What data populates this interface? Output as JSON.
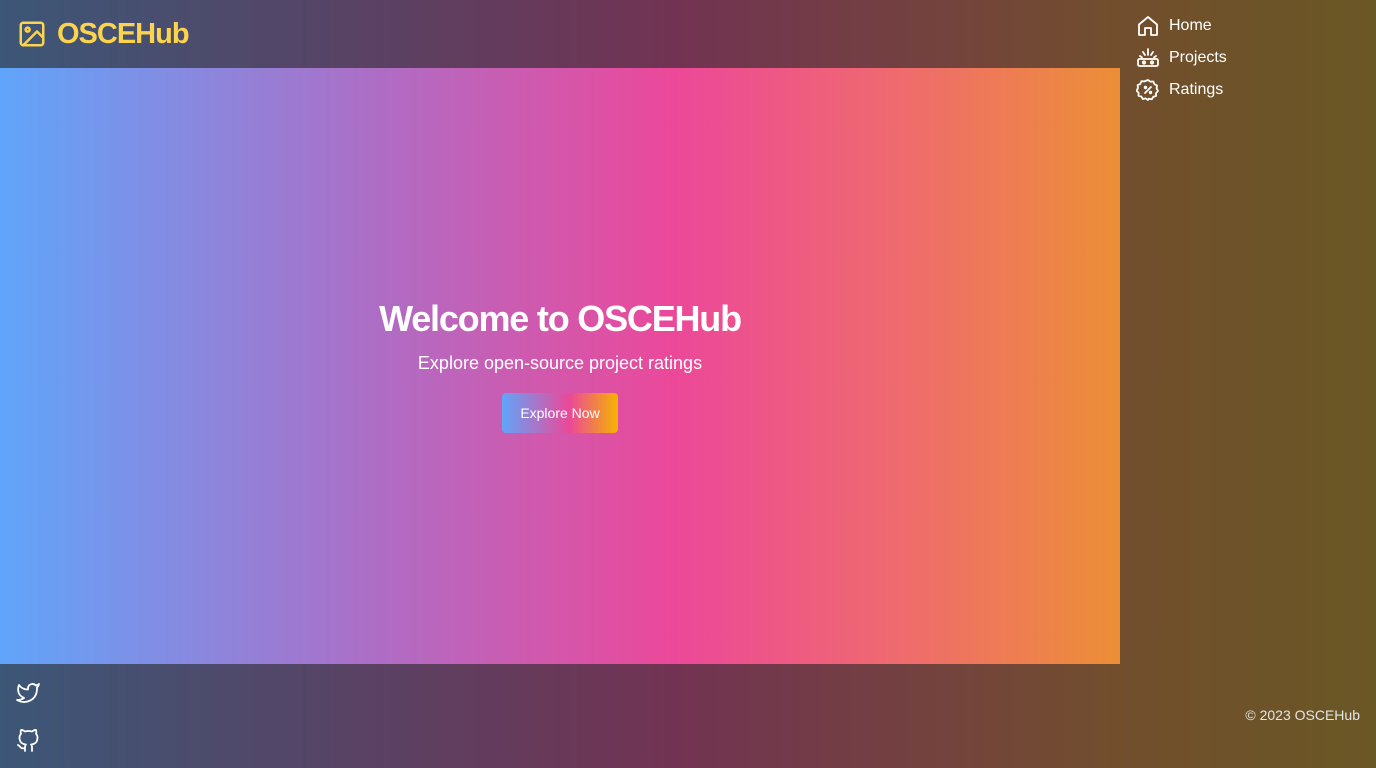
{
  "brand": {
    "name": "OSCEHub",
    "icon": "image-icon",
    "color": "#fcd34d"
  },
  "nav": {
    "items": [
      {
        "label": "Home",
        "icon": "home-icon"
      },
      {
        "label": "Projects",
        "icon": "projects-icon"
      },
      {
        "label": "Ratings",
        "icon": "ratings-badge-icon"
      }
    ]
  },
  "hero": {
    "title": "Welcome to OSCEHub",
    "subtitle": "Explore open-source project ratings",
    "cta_label": "Explore Now"
  },
  "footer": {
    "social": [
      {
        "icon": "twitter-icon"
      },
      {
        "icon": "github-icon"
      }
    ],
    "copyright": "© 2023 OSCEHub"
  },
  "colors": {
    "gradient": [
      "#60a5fa",
      "#ec4899",
      "#d6a623"
    ],
    "overlay": "#262626",
    "text": "#ffffff"
  }
}
